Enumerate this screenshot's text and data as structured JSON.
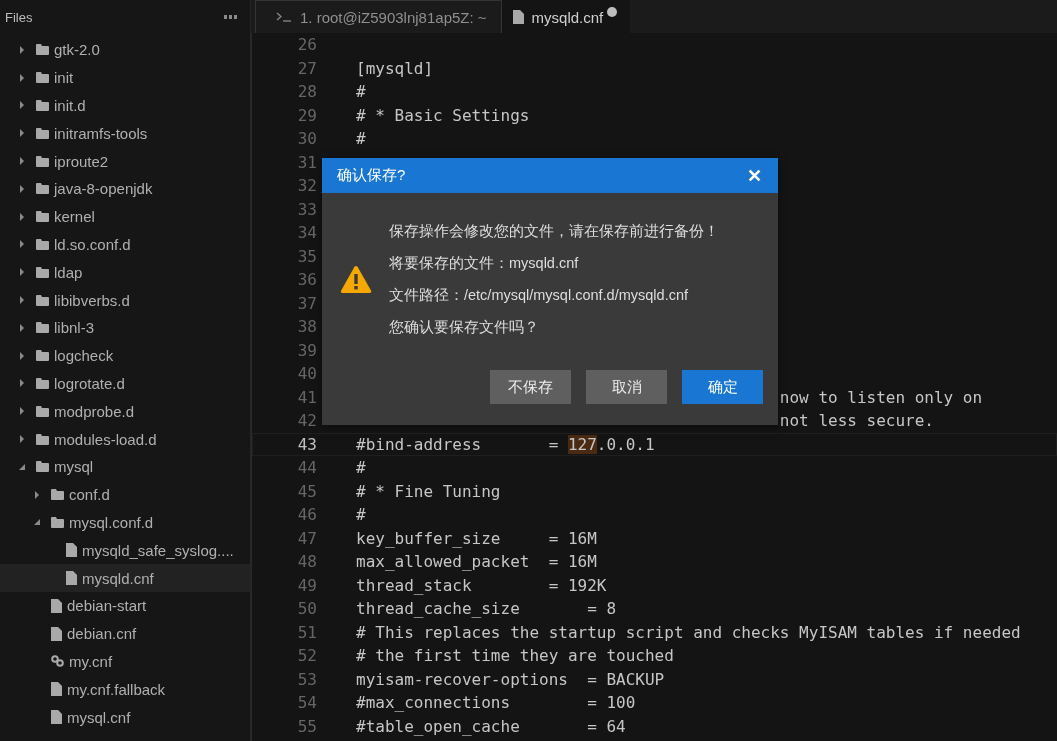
{
  "sidebar": {
    "title": "Files",
    "tree": [
      {
        "name": "gtk-2.0",
        "kind": "folder",
        "expanded": false,
        "selected": false
      },
      {
        "name": "init",
        "kind": "folder",
        "expanded": false,
        "selected": false
      },
      {
        "name": "init.d",
        "kind": "folder",
        "expanded": false,
        "selected": false
      },
      {
        "name": "initramfs-tools",
        "kind": "folder",
        "expanded": false,
        "selected": false
      },
      {
        "name": "iproute2",
        "kind": "folder",
        "expanded": false,
        "selected": false
      },
      {
        "name": "java-8-openjdk",
        "kind": "folder",
        "expanded": false,
        "selected": false
      },
      {
        "name": "kernel",
        "kind": "folder",
        "expanded": false,
        "selected": false
      },
      {
        "name": "ld.so.conf.d",
        "kind": "folder",
        "expanded": false,
        "selected": false
      },
      {
        "name": "ldap",
        "kind": "folder",
        "expanded": false,
        "selected": false
      },
      {
        "name": "libibverbs.d",
        "kind": "folder",
        "expanded": false,
        "selected": false
      },
      {
        "name": "libnl-3",
        "kind": "folder",
        "expanded": false,
        "selected": false
      },
      {
        "name": "logcheck",
        "kind": "folder",
        "expanded": false,
        "selected": false
      },
      {
        "name": "logrotate.d",
        "kind": "folder",
        "expanded": false,
        "selected": false
      },
      {
        "name": "modprobe.d",
        "kind": "folder",
        "expanded": false,
        "selected": false
      },
      {
        "name": "modules-load.d",
        "kind": "folder",
        "expanded": false,
        "selected": false
      },
      {
        "name": "mysql",
        "kind": "folder",
        "expanded": true,
        "selected": false,
        "children": [
          {
            "name": "conf.d",
            "kind": "folder",
            "expanded": false,
            "selected": false
          },
          {
            "name": "mysql.conf.d",
            "kind": "folder",
            "expanded": true,
            "selected": false,
            "children": [
              {
                "name": "mysqld_safe_syslog....",
                "kind": "file",
                "selected": false
              },
              {
                "name": "mysqld.cnf",
                "kind": "file",
                "selected": true
              }
            ]
          },
          {
            "name": "debian-start",
            "kind": "file",
            "selected": false
          },
          {
            "name": "debian.cnf",
            "kind": "file",
            "selected": false
          },
          {
            "name": "my.cnf",
            "kind": "link",
            "selected": false
          },
          {
            "name": "my.cnf.fallback",
            "kind": "file",
            "selected": false
          },
          {
            "name": "mysql.cnf",
            "kind": "file",
            "selected": false
          }
        ]
      }
    ]
  },
  "tabs": [
    {
      "label": "1. root@iZ5903lnj81ap5Z: ~",
      "kind": "terminal",
      "selected": false,
      "modified": false
    },
    {
      "label": "mysqld.cnf",
      "kind": "file",
      "selected": true,
      "modified": true
    }
  ],
  "editor": {
    "lines": [
      {
        "number": "26",
        "selected": false
      },
      {
        "number": "27",
        "text": "[mysqld]",
        "selected": false
      },
      {
        "number": "28",
        "text": "#",
        "selected": false
      },
      {
        "number": "29",
        "text": "# * Basic Settings",
        "selected": false
      },
      {
        "number": "30",
        "text": "#",
        "selected": false
      },
      {
        "number": "31",
        "selected": false
      },
      {
        "number": "32",
        "selected": false
      },
      {
        "number": "33",
        "selected": false
      },
      {
        "number": "34",
        "selected": false
      },
      {
        "number": "35",
        "selected": false
      },
      {
        "number": "36",
        "selected": false
      },
      {
        "number": "37",
        "selected": false
      },
      {
        "number": "38",
        "selected": false
      },
      {
        "number": "39",
        "selected": false
      },
      {
        "number": "40",
        "selected": false
      },
      {
        "number": "41",
        "text": "now to listen only on",
        "kind": "tail",
        "selected": false
      },
      {
        "number": "42",
        "text": "not less secure.",
        "kind": "tail",
        "selected": false
      },
      {
        "number": "43",
        "text": "#bind-address       = ",
        "match": "127",
        "after": ".0.0.1",
        "selected": true
      },
      {
        "number": "44",
        "text": "#",
        "selected": false
      },
      {
        "number": "45",
        "text": "# * Fine Tuning",
        "selected": false
      },
      {
        "number": "46",
        "text": "#",
        "selected": false
      },
      {
        "number": "47",
        "text": "key_buffer_size     = 16M",
        "selected": false
      },
      {
        "number": "48",
        "text": "max_allowed_packet  = 16M",
        "selected": false
      },
      {
        "number": "49",
        "text": "thread_stack        = 192K",
        "selected": false
      },
      {
        "number": "50",
        "text": "thread_cache_size       = 8",
        "selected": false
      },
      {
        "number": "51",
        "text": "# This replaces the startup script and checks MyISAM tables if needed",
        "selected": false
      },
      {
        "number": "52",
        "text": "# the first time they are touched",
        "selected": false
      },
      {
        "number": "53",
        "text": "myisam-recover-options  = BACKUP",
        "selected": false
      },
      {
        "number": "54",
        "text": "#max_connections        = 100",
        "selected": false
      },
      {
        "number": "55",
        "text": "#table_open_cache       = 64",
        "selected": false
      }
    ]
  },
  "dialog": {
    "title": "确认保存?",
    "close": "✕",
    "messages": [
      "保存操作会修改您的文件，请在保存前进行备份！",
      "将要保存的文件：mysqld.cnf",
      "文件路径：/etc/mysql/mysql.conf.d/mysqld.cnf",
      "您确认要保存文件吗？"
    ],
    "buttons": [
      {
        "label": "不保存",
        "kind": "secondary"
      },
      {
        "label": "取消",
        "kind": "secondary"
      },
      {
        "label": "确定",
        "kind": "primary"
      }
    ]
  }
}
